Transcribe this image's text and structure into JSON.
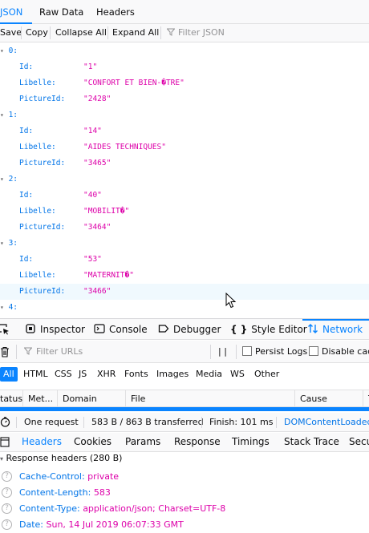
{
  "json_tabs": [
    "JSON",
    "Raw Data",
    "Headers"
  ],
  "json_toolbar": {
    "save": "Save",
    "copy": "Copy",
    "collapse_all": "Collapse All",
    "expand_all": "Expand All",
    "filter_placeholder": "Filter JSON"
  },
  "json_items": [
    {
      "index": "0:",
      "fields": [
        [
          "Id:",
          "\"1\""
        ],
        [
          "Libelle:",
          "\"CONFORT ET BIEN-�TRE\""
        ],
        [
          "PictureId:",
          "\"2428\""
        ]
      ]
    },
    {
      "index": "1:",
      "fields": [
        [
          "Id:",
          "\"14\""
        ],
        [
          "Libelle:",
          "\"AIDES TECHNIQUES\""
        ],
        [
          "PictureId:",
          "\"3465\""
        ]
      ]
    },
    {
      "index": "2:",
      "fields": [
        [
          "Id:",
          "\"40\""
        ],
        [
          "Libelle:",
          "\"MOBILIT�\""
        ],
        [
          "PictureId:",
          "\"3464\""
        ]
      ]
    },
    {
      "index": "3:",
      "fields": [
        [
          "Id:",
          "\"53\""
        ],
        [
          "Libelle:",
          "\"MATERNIT�\""
        ],
        [
          "PictureId:",
          "\"3466\""
        ]
      ]
    },
    {
      "index": "4:",
      "fields": []
    }
  ],
  "devtools_tabs": [
    "Inspector",
    "Console",
    "Debugger",
    "Style Editor",
    "Network"
  ],
  "network_toolbar": {
    "filter_placeholder": "Filter URLs",
    "pause": "| |",
    "persist_logs": "Persist Logs",
    "disable_cache": "Disable cac"
  },
  "type_filters": [
    "All",
    "HTML",
    "CSS",
    "JS",
    "XHR",
    "Fonts",
    "Images",
    "Media",
    "WS",
    "Other"
  ],
  "columns": [
    "tatus",
    "Met...",
    "Domain",
    "File",
    "Cause",
    "T"
  ],
  "summary": {
    "requests": "One request",
    "transferred": "583 B / 863 B transferred",
    "finish": "Finish: 101 ms",
    "dom_loaded": "DOMContentLoaded"
  },
  "detail_tabs": [
    "Headers",
    "Cookies",
    "Params",
    "Response",
    "Timings",
    "Stack Trace",
    "Secu"
  ],
  "response_headers": {
    "title": "Response headers (280 B)",
    "items": [
      [
        "Cache-Control:",
        "private"
      ],
      [
        "Content-Length:",
        "583"
      ],
      [
        "Content-Type:",
        "application/json; Charset=UTF-8"
      ],
      [
        "Date:",
        "Sun, 14 Jul 2019 06:07:33 GMT"
      ]
    ]
  },
  "colors": {
    "accent": "#0a84ff",
    "key_blue": "#0074e8",
    "string_pink": "#dd00a9"
  }
}
